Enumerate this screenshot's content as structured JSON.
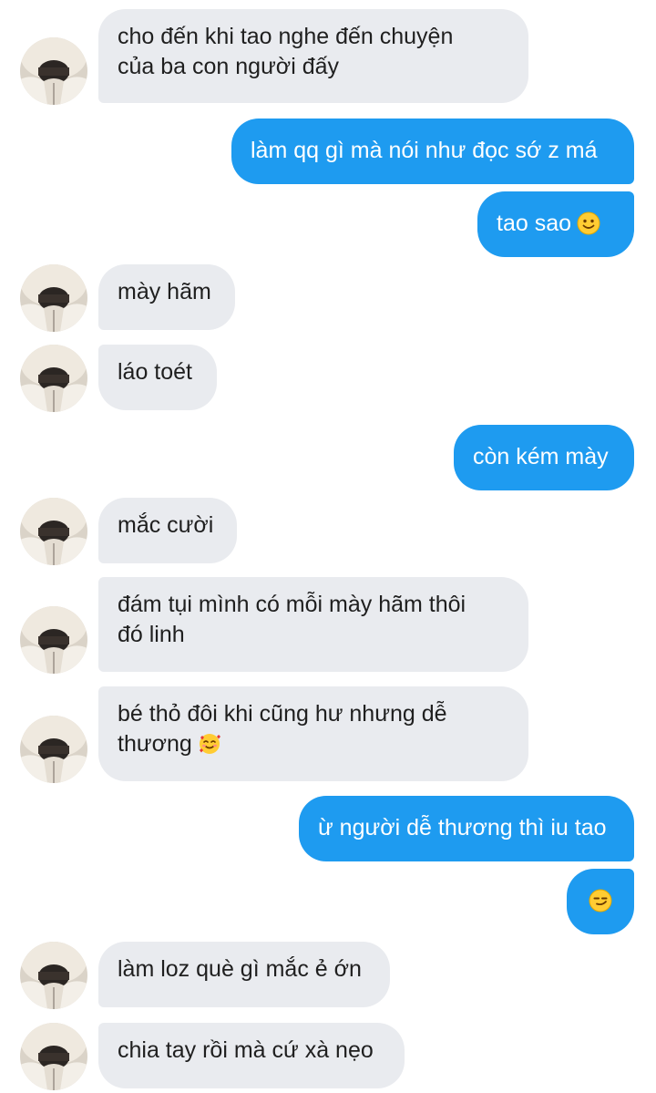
{
  "messages": [
    {
      "side": "in",
      "lines": [
        "cho đến khi tao nghe đến chuyện",
        "của ba con người đấy"
      ],
      "avatar": true
    },
    {
      "side": "out",
      "lines": [
        "làm qq gì mà nói như đọc sớ z má"
      ]
    },
    {
      "side": "out",
      "lines": [
        "tao sao"
      ],
      "emoji": "slightly-smiling-face-icon"
    },
    {
      "side": "in",
      "lines": [
        "mày hãm"
      ],
      "avatar": true
    },
    {
      "side": "in",
      "lines": [
        "láo toét"
      ],
      "avatar": true
    },
    {
      "side": "out",
      "lines": [
        "còn kém mày"
      ]
    },
    {
      "side": "in",
      "lines": [
        "mắc cười"
      ],
      "avatar": true
    },
    {
      "side": "in",
      "lines": [
        "đám tụi mình có mỗi mày hãm thôi",
        "đó linh"
      ],
      "avatar": true
    },
    {
      "side": "in",
      "lines": [
        "bé thỏ đôi khi cũng hư nhưng dễ",
        "thương"
      ],
      "emoji": "smiling-face-with-hearts-icon",
      "avatar": true
    },
    {
      "side": "out",
      "lines": [
        "ừ người dễ thương thì iu tao"
      ]
    },
    {
      "side": "out",
      "lines": [],
      "emoji": "smirking-face-icon"
    },
    {
      "side": "in",
      "lines": [
        "làm loz què gì mắc ẻ ớn"
      ],
      "avatar": true
    },
    {
      "side": "in",
      "lines": [
        "chia tay rồi mà cứ xà nẹo"
      ],
      "avatar": true
    }
  ],
  "colors": {
    "incoming_bubble": "#e9ebef",
    "outgoing_bubble": "#1e9bf0",
    "incoming_text": "#1f1f1f",
    "outgoing_text": "#ffffff"
  }
}
